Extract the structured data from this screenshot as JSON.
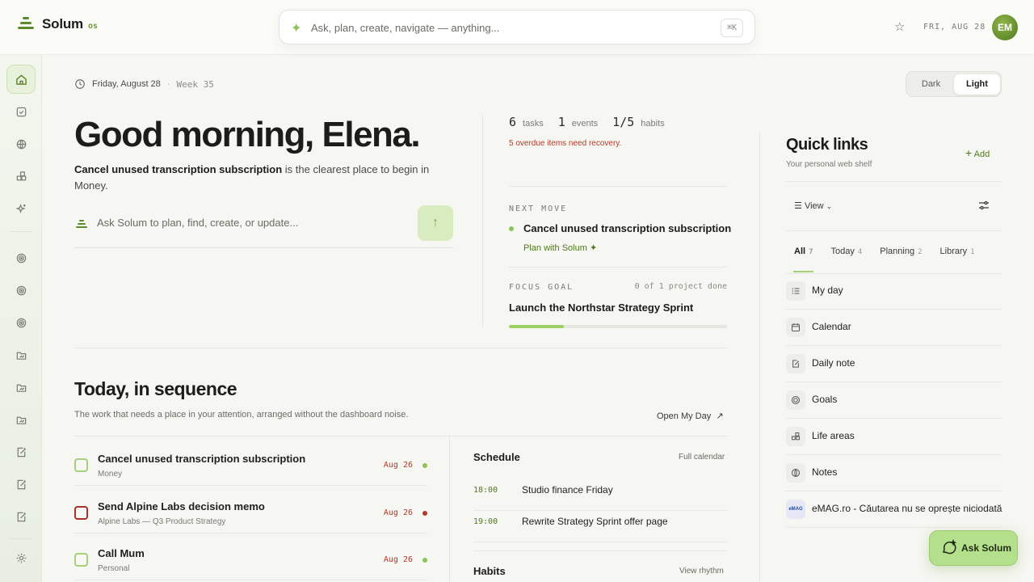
{
  "brand": {
    "name": "Solum",
    "suffix": "os"
  },
  "search": {
    "placeholder": "Ask, plan, create, navigate — anything...",
    "shortcut": "⌘K"
  },
  "topbar": {
    "date": "FRI, AUG 28",
    "avatar": "EM"
  },
  "datebar": {
    "date": "Friday, August 28",
    "separator": "·",
    "week": "Week 35"
  },
  "theme": {
    "dark": "Dark",
    "light": "Light",
    "selected": "Light"
  },
  "greeting": {
    "title": "Good morning, Elena.",
    "focus_task": "Cancel unused transcription subscription",
    "rest": " is the clearest place to begin in Money."
  },
  "ask": {
    "placeholder": "Ask Solum to plan, find, create, or update..."
  },
  "stats": [
    {
      "value": "6",
      "label": "tasks"
    },
    {
      "value": "1",
      "label": "events"
    },
    {
      "value": "1/5",
      "label": "habits"
    }
  ],
  "overdue": "5 overdue items need recovery.",
  "next_move": {
    "eyebrow": "NEXT MOVE",
    "title": "Cancel unused transcription subscription",
    "action": "Plan with Solum"
  },
  "focus_goal": {
    "eyebrow": "FOCUS GOAL",
    "count": "0 of 1 project done",
    "title": "Launch the Northstar Strategy Sprint",
    "progress": 0.25
  },
  "sequence": {
    "title": "Today, in sequence",
    "subtitle": "The work that needs a place in your attention, arranged without the dashboard noise.",
    "link": "Open My Day"
  },
  "tasks": [
    {
      "title": "Cancel unused transcription subscription",
      "sub": "Money",
      "date": "Aug 26"
    },
    {
      "title": "Send Alpine Labs decision memo",
      "sub": "Alpine Labs — Q3 Product Strategy",
      "date": "Aug 26"
    },
    {
      "title": "Call Mum",
      "sub": "Personal",
      "date": "Aug 26"
    }
  ],
  "schedule": {
    "title": "Schedule",
    "link": "Full calendar",
    "events": [
      {
        "time": "18:00",
        "name": "Studio finance Friday"
      },
      {
        "time": "19:00",
        "name": "Rewrite Strategy Sprint offer page"
      }
    ]
  },
  "habits": {
    "title": "Habits",
    "link": "View rhythm"
  },
  "quick_links": {
    "title": "Quick links",
    "subtitle": "Your personal web shelf",
    "add": "Add",
    "view": "View",
    "tabs": [
      {
        "label": "All",
        "count": "7"
      },
      {
        "label": "Today",
        "count": "4"
      },
      {
        "label": "Planning",
        "count": "2"
      },
      {
        "label": "Library",
        "count": "1"
      }
    ],
    "links": [
      {
        "label": "My day",
        "icon": "list-icon"
      },
      {
        "label": "Calendar",
        "icon": "calendar-icon"
      },
      {
        "label": "Daily note",
        "icon": "note-icon"
      },
      {
        "label": "Goals",
        "icon": "target-icon"
      },
      {
        "label": "Life areas",
        "icon": "grid-icon"
      },
      {
        "label": "Notes",
        "icon": "globe-icon"
      },
      {
        "label": "eMAG.ro - Căutarea nu se oprește niciodată",
        "icon": "emag-icon"
      }
    ]
  },
  "ask_button": "Ask Solum",
  "colors": {
    "accent": "#8cc35a",
    "accent_dark": "#4f7a1f",
    "danger": "#b33a2a",
    "ask_button": "#b5e08b"
  }
}
